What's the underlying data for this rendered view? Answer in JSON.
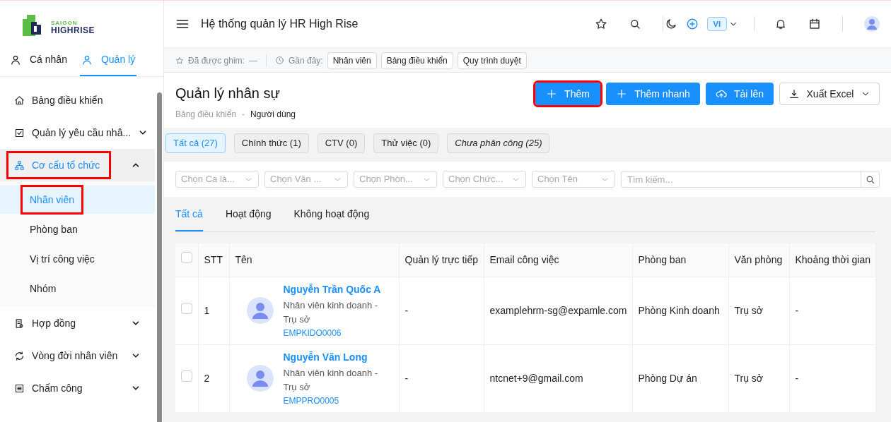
{
  "sidebar": {
    "logo": {
      "line1": "SAIGON",
      "line2": "HIGHRISE"
    },
    "tabs": [
      {
        "label": "Cá nhân",
        "selected": false
      },
      {
        "label": "Quản lý",
        "selected": true
      }
    ],
    "menu": [
      {
        "label": "Bảng điều khiển",
        "highlighted": false
      },
      {
        "label": "Quản lý yêu cầu nhâ...",
        "expanded": false,
        "highlighted": false
      },
      {
        "label": "Cơ cấu tổ chức",
        "expanded": true,
        "highlighted": true,
        "children": [
          {
            "label": "Nhân viên",
            "selected": true,
            "highlighted": true
          },
          {
            "label": "Phòng ban",
            "selected": false,
            "highlighted": false
          },
          {
            "label": "Vị trí công việc",
            "selected": false,
            "highlighted": false
          },
          {
            "label": "Nhóm",
            "selected": false,
            "highlighted": false
          }
        ]
      },
      {
        "label": "Hợp đồng",
        "expanded": false,
        "highlighted": false
      },
      {
        "label": "Vòng đời nhân viên",
        "expanded": false,
        "highlighted": false
      },
      {
        "label": "Chấm công",
        "expanded": false,
        "highlighted": false
      }
    ]
  },
  "header": {
    "title": "Hệ thống quản lý HR High Rise",
    "language": "VI"
  },
  "pinned_bar": {
    "pinned_label": "Đã được ghim:",
    "pinned_value": "—",
    "recent_label": "Gần đây:",
    "recent": [
      "Nhân viên",
      "Bảng điều khiển",
      "Quy trình duyệt"
    ]
  },
  "page": {
    "title": "Quản lý nhân sự",
    "breadcrumb": [
      "Bảng điều khiển",
      "Người dùng"
    ],
    "breadcrumb_separator": "-",
    "actions": [
      {
        "label": "Thêm",
        "kind": "primary",
        "highlighted": true
      },
      {
        "label": "Thêm nhanh",
        "kind": "primary",
        "highlighted": false
      },
      {
        "label": "Tải lên",
        "kind": "upload",
        "highlighted": false
      },
      {
        "label": "Xuất Excel",
        "kind": "export",
        "highlighted": false
      }
    ]
  },
  "status_filters": [
    {
      "label": "Tất cả (27)",
      "selected": true,
      "emphasized": false
    },
    {
      "label": "Chính thức (1)",
      "selected": false,
      "emphasized": false
    },
    {
      "label": "CTV (0)",
      "selected": false,
      "emphasized": false
    },
    {
      "label": "Thử việc (0)",
      "selected": false,
      "emphasized": false
    },
    {
      "label": "Chưa phân công (25)",
      "selected": false,
      "emphasized": true
    }
  ],
  "filters": [
    {
      "placeholder": "Chọn Ca là..."
    },
    {
      "placeholder": "Chọn Văn ..."
    },
    {
      "placeholder": "Chọn Phòn..."
    },
    {
      "placeholder": "Chọn Chức..."
    },
    {
      "placeholder": "Chọn Tên"
    }
  ],
  "search": {
    "placeholder": "Tìm kiếm..."
  },
  "tabs": [
    {
      "label": "Tất cả",
      "selected": true
    },
    {
      "label": "Hoạt động",
      "selected": false
    },
    {
      "label": "Không hoạt động",
      "selected": false
    }
  ],
  "table": {
    "header_checked": false,
    "columns": [
      "STT",
      "Tên",
      "Quản lý trực tiếp",
      "Email công việc",
      "Phòng ban",
      "Văn phòng",
      "Khoảng thời gian"
    ],
    "rows": [
      {
        "checked": false,
        "stt": "1",
        "name": "Nguyễn Trần Quốc A",
        "position": "Nhân viên kinh doanh - Trụ sở",
        "code": "EMPKIDO0006",
        "manager": "-",
        "email": "examplehrm-sg@expamle.com",
        "department": "Phòng Kinh doanh",
        "office": "Trụ sở",
        "period": "-"
      },
      {
        "checked": false,
        "stt": "2",
        "name": "Nguyễn Văn Long",
        "position": "Nhân viên kinh doanh - Trụ sở",
        "code": "EMPPRO0005",
        "manager": "-",
        "email": "ntcnet+9@gmail.com",
        "department": "Phòng Dự án",
        "office": "Trụ sở",
        "period": "-"
      }
    ]
  }
}
